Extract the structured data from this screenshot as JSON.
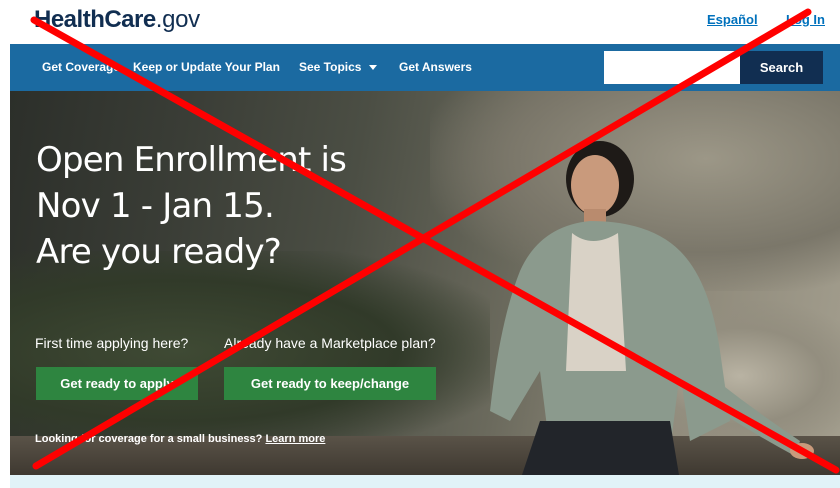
{
  "header": {
    "logo_part1": "HealthCare",
    "logo_part2": ".gov",
    "link_espanol": "Español",
    "link_login": "Log In"
  },
  "nav": {
    "items": [
      {
        "label": "Get Coverage"
      },
      {
        "label": "Keep or Update Your Plan"
      },
      {
        "label": "See Topics"
      },
      {
        "label": "Get Answers"
      }
    ],
    "search_value": "",
    "search_button": "Search"
  },
  "hero": {
    "title_lines": [
      "Open Enrollment is",
      "Nov 1 - Jan 15.",
      "Are you ready?"
    ],
    "question_first_time": "First time applying here?",
    "question_existing": "Already have a Marketplace plan?",
    "button_apply": "Get ready to apply",
    "button_keep": "Get ready to keep/change",
    "small_business_text": "Looking for coverage for a small business?",
    "small_business_link": "Learn more"
  },
  "colors": {
    "brand_navy": "#112e51",
    "nav_blue": "#1b6aa1",
    "link_blue": "#0071bc",
    "button_green": "#2e8540",
    "overlay_red": "#ff0000"
  }
}
